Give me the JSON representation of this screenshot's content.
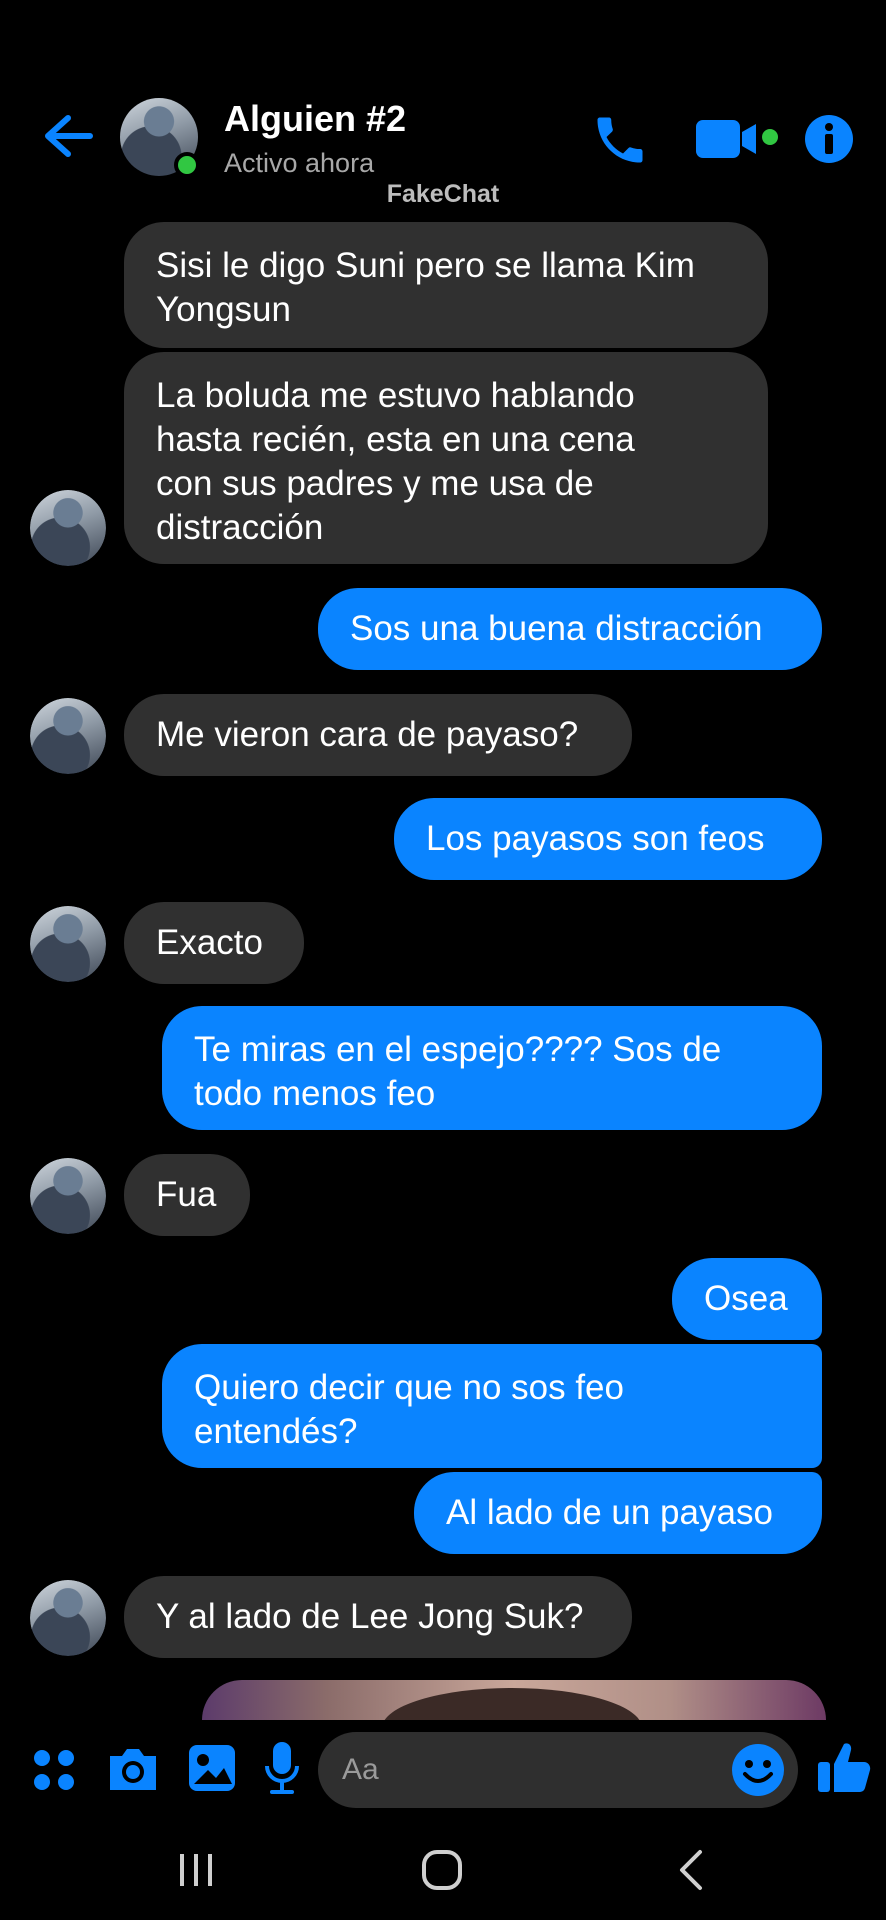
{
  "header": {
    "contact_name": "Alguien #2",
    "status": "Activo ahora",
    "watermark": "FakeChat"
  },
  "icons": {
    "back": "arrow-left-icon",
    "call": "phone-icon",
    "video": "video-camera-icon",
    "info": "info-icon",
    "apps": "apps-grid-icon",
    "camera": "camera-icon",
    "gallery": "image-icon",
    "mic": "microphone-icon",
    "emoji": "emoji-icon",
    "like": "thumbs-up-icon"
  },
  "colors": {
    "accent": "#0a84ff",
    "incoming_bubble": "#303030",
    "online": "#31c742"
  },
  "messages": [
    {
      "dir": "in",
      "text": "Sisi le digo Suni pero se llama Kim\nYongsun"
    },
    {
      "dir": "in",
      "text": "La boluda me estuvo hablando\nhasta recién, esta en una cena\ncon sus padres y me usa de\ndistracción"
    },
    {
      "dir": "out",
      "text": "Sos una buena distracción"
    },
    {
      "dir": "in",
      "text": "Me vieron cara de payaso?"
    },
    {
      "dir": "out",
      "text": "Los payasos son feos"
    },
    {
      "dir": "in",
      "text": "Exacto"
    },
    {
      "dir": "out",
      "text": "Te miras en el espejo???? Sos de\ntodo menos feo"
    },
    {
      "dir": "in",
      "text": "Fua"
    },
    {
      "dir": "out",
      "text": "Osea"
    },
    {
      "dir": "out",
      "text": "Quiero decir que no sos feo\nentendés?"
    },
    {
      "dir": "out",
      "text": "Al lado de un payaso"
    },
    {
      "dir": "in",
      "text": "Y al lado de Lee Jong Suk?"
    }
  ],
  "composer": {
    "placeholder": "Aa"
  }
}
